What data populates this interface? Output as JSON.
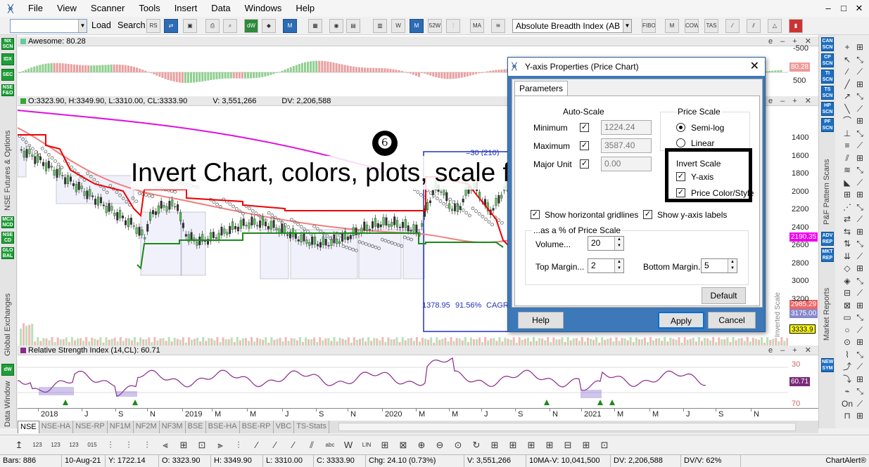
{
  "menu": {
    "items": [
      "File",
      "View",
      "Scanner",
      "Tools",
      "Insert",
      "Data",
      "Windows",
      "Help"
    ],
    "window_controls": [
      "–",
      "□",
      "✕"
    ]
  },
  "toolbar": {
    "symbol_value": "",
    "load_label": "Load",
    "search_label": "Search",
    "indicator_select": "Absolute Breadth Index (AB"
  },
  "left_sidebar": {
    "buttons": [
      "NX SCN",
      "IDX",
      "SEC",
      "NSE F&O",
      "MCX NCD",
      "NSE CD",
      "GLO BAL",
      "dW"
    ],
    "labels": [
      "NSE Futures & Options",
      "Global Exchanges",
      "Data Window"
    ]
  },
  "right_sidebar": {
    "buttons": [
      "CAN SCN",
      "CP SCN",
      "TI SCN",
      "TS SCN",
      "HP SCN",
      "PF SCN",
      "ADV REP",
      "MKT REP",
      "NEW SYM"
    ],
    "labels": [
      "P&F Pattern Scans",
      "Market Reports"
    ]
  },
  "panes": {
    "awesome": {
      "header": "Awesome: 80.28",
      "axis": [
        "-500",
        "0",
        "500"
      ],
      "last_value": "80.28"
    },
    "price": {
      "header_o": "O:3323.90, H:3349.90, L:3310.00, CL:3333.90",
      "header_v": "V: 3,551,266",
      "header_dv": "DV: 2,206,588",
      "axis": [
        "1400",
        "1600",
        "1800",
        "2000",
        "2200",
        "2400",
        "2600",
        "2800",
        "3000",
        "3200"
      ],
      "tags": [
        "2190.35",
        "2985.29",
        "3175.00",
        "3333.9"
      ],
      "box_label": "=30 (210)",
      "stats": [
        "1378.95",
        "91.56%",
        "CAGR"
      ],
      "inverted_label": "Inverted Scale"
    },
    "rsi": {
      "header": "Relative Strength Index (14,CL): 60.71",
      "axis": [
        "30",
        "70"
      ],
      "last_value": "60.71"
    }
  },
  "chart_data": {
    "type": "candlestick",
    "date_axis": [
      "2018",
      "J",
      "S",
      "N",
      "2019",
      "M",
      "M",
      "J",
      "S",
      "N",
      "2020",
      "M",
      "M",
      "J",
      "S",
      "N",
      "2021",
      "M",
      "M",
      "J",
      "S",
      "N"
    ],
    "price_range": [
      1400,
      3200
    ],
    "last_close": 3333.9
  },
  "tabs": [
    "NSE",
    "NSE-HA",
    "NSE-RP",
    "NF1M",
    "NF2M",
    "NF3M",
    "BSE",
    "BSE-HA",
    "BSE-RP",
    "VBC",
    "TS-Stats"
  ],
  "status": {
    "bars": "Bars: 886",
    "date": "10-Aug-21",
    "y": "Y: 1722.14",
    "o": "O: 3323.90",
    "h": "H: 3349.90",
    "l": "L: 3310.00",
    "c": "C: 3333.90",
    "chg": "Chg: 24.10 (0.73%)",
    "v": "V: 3,551,266",
    "ma": "10MA-V: 10,041,500",
    "dv": "DV: 2,206,588",
    "dvv": "DV/V: 62%",
    "brand": "ChartAlert®"
  },
  "annotation": {
    "number": "❻",
    "text": "Invert Chart, colors, plots, scale from here"
  },
  "dialog": {
    "title": "Y-axis Properties (Price Chart)",
    "tab": "Parameters",
    "autoscale_label": "Auto-Scale",
    "minimum_label": "Minimum",
    "minimum_value": "1224.24",
    "maximum_label": "Maximum",
    "maximum_value": "3587.40",
    "major_label": "Major Unit",
    "major_value": "0.00",
    "price_scale_label": "Price Scale",
    "semilog_label": "Semi-log",
    "linear_label": "Linear",
    "invert_label": "Invert Scale",
    "yaxis_label": "Y-axis",
    "pricecolor_label": "Price Color/Style",
    "gridlines_label": "Show horizontal gridlines",
    "ylabels_label": "Show y-axis labels",
    "pct_label": "...as a % of Price Scale",
    "volume_label": "Volume...",
    "volume_value": "20",
    "topmargin_label": "Top Margin...",
    "topmargin_value": "2",
    "bottommargin_label": "Bottom Margin...",
    "bottommargin_value": "5",
    "default_label": "Default",
    "help_label": "Help",
    "apply_label": "Apply",
    "cancel_label": "Cancel"
  }
}
